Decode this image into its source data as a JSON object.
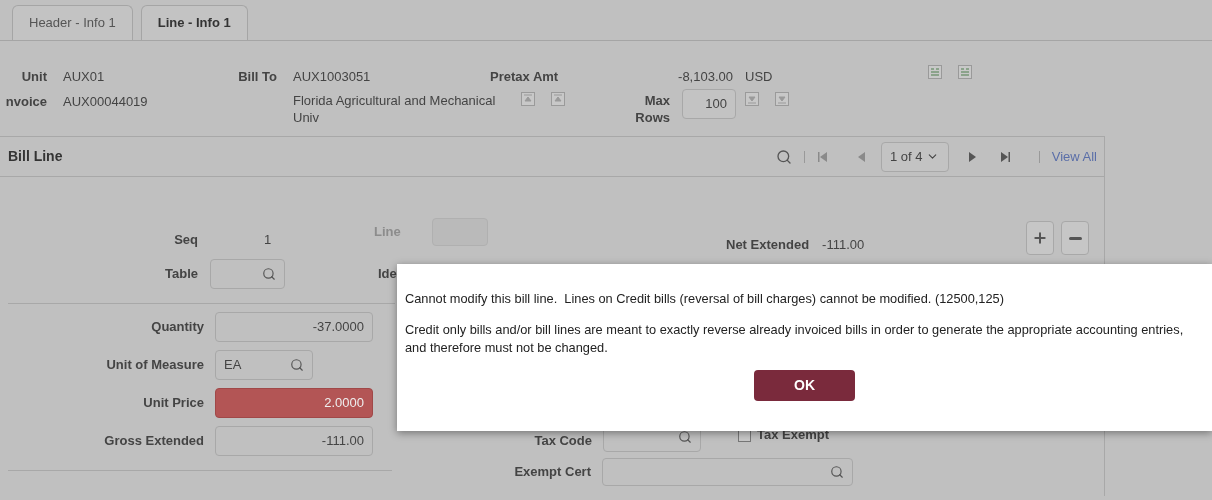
{
  "tabs": [
    {
      "label": "Header - Info 1",
      "selected": false
    },
    {
      "label": "Line - Info 1",
      "selected": true
    }
  ],
  "header": {
    "unit": {
      "label": "Unit",
      "value": "AUX01"
    },
    "invoice": {
      "label": "nvoice",
      "value": "AUX00044019"
    },
    "bill_to": {
      "label": "Bill To",
      "value": "AUX1003051",
      "name": "Florida Agricultural and Mechanical Univ"
    },
    "pretax_amt": {
      "label": "Pretax Amt",
      "value": "-8,103.00",
      "currency": "USD"
    },
    "max_rows": {
      "label": "Max Rows",
      "value": "100"
    }
  },
  "bill_line": {
    "title": "Bill Line",
    "pager": {
      "page": "1 of 4",
      "view_all": "View All"
    },
    "seq": {
      "label": "Seq",
      "value": "1"
    },
    "line": {
      "label": "Line",
      "disabled": true
    },
    "net_extended": {
      "label": "Net Extended",
      "value": "-111.00"
    },
    "table": {
      "label": "Table"
    },
    "identifier_label": "Ide",
    "fields": [
      {
        "kind": "number",
        "label": "Quantity",
        "value": "-37.0000",
        "error": false
      },
      {
        "kind": "lookup",
        "label": "Unit of Measure",
        "value": "EA",
        "error": false
      },
      {
        "kind": "number",
        "label": "Unit Price",
        "value": "2.0000",
        "error": true
      },
      {
        "kind": "number",
        "label": "Gross Extended",
        "value": "-111.00",
        "error": false
      }
    ],
    "tax_code": {
      "label": "Tax Code"
    },
    "tax_exempt": {
      "label": "Tax Exempt",
      "checked": false
    },
    "exempt_cert": {
      "label": "Exempt Cert"
    }
  },
  "dialog": {
    "messages": [
      "Cannot modify this bill line.  Lines on Credit bills (reversal of bill charges) cannot be modified. (12500,125)",
      "Credit only bills and/or bill lines are meant to exactly reverse already invoiced bills in order to generate the appropriate accounting entries, and therefore must not be changed."
    ],
    "button": "OK"
  }
}
